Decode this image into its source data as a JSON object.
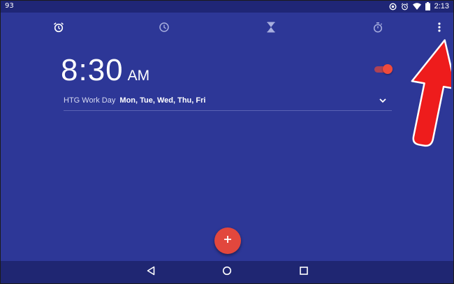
{
  "status_bar": {
    "left_indicator": "93",
    "time": "2:13",
    "icons": [
      "sync-icon",
      "alarm-icon",
      "wifi-icon",
      "battery-icon"
    ]
  },
  "tabs": [
    {
      "name": "alarm",
      "icon": "alarm-clock-icon",
      "selected": true
    },
    {
      "name": "clock",
      "icon": "clock-icon",
      "selected": false
    },
    {
      "name": "timer",
      "icon": "hourglass-icon",
      "selected": false
    },
    {
      "name": "stopwatch",
      "icon": "stopwatch-icon",
      "selected": false
    }
  ],
  "overflow_menu_icon": "more-vert-icon",
  "alarm": {
    "time": "8:30",
    "ampm": "AM",
    "enabled": true,
    "label": "HTG Work Day",
    "days": "Mon, Tue, Wed, Thu, Fri"
  },
  "fab": {
    "icon": "plus-icon",
    "glyph": "+"
  },
  "nav_bar": {
    "buttons": [
      "back-icon",
      "home-icon",
      "recents-icon"
    ]
  },
  "colors": {
    "background": "#2d3797",
    "status_bar": "#1f2676",
    "accent": "#e2473d",
    "annotation_arrow": "#ee1c1c"
  }
}
